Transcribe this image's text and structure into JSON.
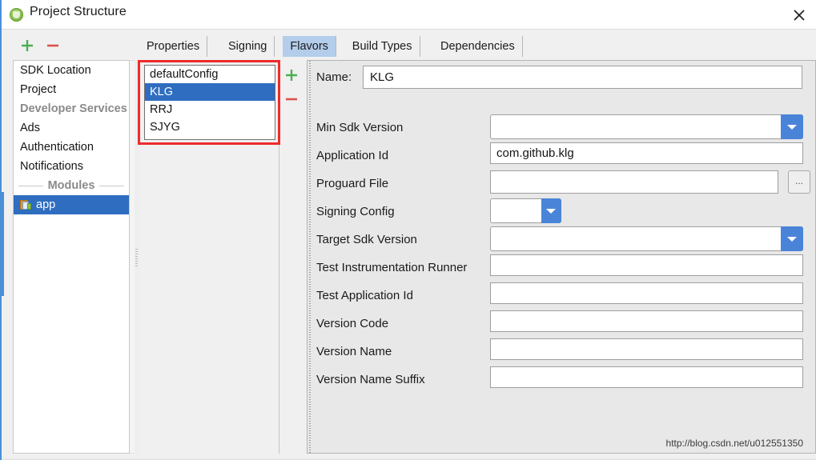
{
  "window": {
    "title": "Project Structure",
    "icon": "android-studio-icon",
    "close_label": "✕"
  },
  "toolbar": {
    "add_label": "+",
    "remove_label": "−"
  },
  "tabs": [
    {
      "label": "Properties",
      "active": false
    },
    {
      "label": "Signing",
      "active": false
    },
    {
      "label": "Flavors",
      "active": true
    },
    {
      "label": "Build Types",
      "active": false
    },
    {
      "label": "Dependencies",
      "active": false
    }
  ],
  "sidebar": {
    "items": [
      {
        "label": "SDK Location",
        "type": "item",
        "selected": false
      },
      {
        "label": "Project",
        "type": "item",
        "selected": false
      },
      {
        "label": "Developer Services",
        "type": "group",
        "selected": false
      },
      {
        "label": "Ads",
        "type": "item",
        "selected": false
      },
      {
        "label": "Authentication",
        "type": "item",
        "selected": false
      },
      {
        "label": "Notifications",
        "type": "item",
        "selected": false
      },
      {
        "label": "Modules",
        "type": "separator",
        "selected": false
      },
      {
        "label": "app",
        "type": "module",
        "selected": true
      }
    ]
  },
  "flavors": {
    "add_label": "+",
    "remove_label": "−",
    "items": [
      {
        "label": "defaultConfig",
        "selected": false
      },
      {
        "label": "KLG",
        "selected": true
      },
      {
        "label": "RRJ",
        "selected": false
      },
      {
        "label": "SJYG",
        "selected": false
      }
    ]
  },
  "detail": {
    "name_label": "Name:",
    "name_value": "KLG",
    "fields": [
      {
        "label": "Min Sdk Version",
        "control": "combo",
        "value": ""
      },
      {
        "label": "Application Id",
        "control": "text",
        "value": "com.github.klg"
      },
      {
        "label": "Proguard File",
        "control": "file",
        "value": "",
        "browse_label": "..."
      },
      {
        "label": "Signing Config",
        "control": "combo-sm",
        "value": ""
      },
      {
        "label": "Target Sdk Version",
        "control": "combo",
        "value": ""
      },
      {
        "label": "Test Instrumentation Runner",
        "control": "text",
        "value": ""
      },
      {
        "label": "Test Application Id",
        "control": "text",
        "value": ""
      },
      {
        "label": "Version Code",
        "control": "text",
        "value": ""
      },
      {
        "label": "Version Name",
        "control": "text",
        "value": ""
      },
      {
        "label": "Version Name Suffix",
        "control": "text",
        "value": ""
      }
    ]
  },
  "watermark": "http://blog.csdn.net/u012551350",
  "colors": {
    "selection_blue": "#2f6dc0",
    "tab_active_blue": "#b3cdeb",
    "dropdown_blue": "#4a84d8",
    "annotation_red": "#ee2b2b",
    "add_green": "#4caf50",
    "remove_red": "#d9534f"
  }
}
